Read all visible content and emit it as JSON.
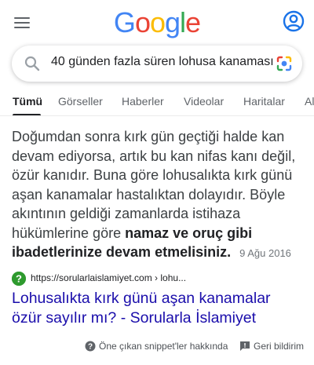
{
  "header": {
    "logo_letters": [
      "G",
      "o",
      "o",
      "g",
      "l",
      "e"
    ],
    "logo_colors": [
      "#4285F4",
      "#EA4335",
      "#FBBC05",
      "#4285F4",
      "#34A853",
      "#EA4335"
    ],
    "menu_icon": "hamburger-menu-icon",
    "account_icon": "account-circle-icon"
  },
  "search": {
    "query": "40 günden fazla süren lohusa kanaması",
    "search_icon": "search-icon",
    "lens_icon": "google-lens-icon"
  },
  "tabs": [
    "Tümü",
    "Görseller",
    "Haberler",
    "Videolar",
    "Haritalar",
    "Al"
  ],
  "snippet": {
    "text_plain": "Doğumdan sonra kırk gün geçtiği halde kan devam ediyorsa, artık bu kan nifas kanı değil, özür kanıdır. Buna göre lohusalıkta kırk günü aşan kanamalar hastalıktan dolayıdır. Böyle akıntının geldiği zamanlarda istihaza hükümlerine göre",
    "text_bold": "namaz ve oruç gibi ibadetlerinize devam etmelisiniz.",
    "date": "9 Ağu 2016"
  },
  "result": {
    "source_url": "https://sorularlaislamiyet.com › lohu...",
    "title": "Lohusalıkta kırk günü aşan kanamalar özür sayılır mı? - Sorularla İslamiyet",
    "favicon_color": "#2e9a2e"
  },
  "footer": {
    "about_label": "Öne çıkan snippet'ler hakkında",
    "feedback_label": "Geri bildirim"
  },
  "colors": {
    "link": "#1a0dab",
    "account": "#1a73e8"
  }
}
